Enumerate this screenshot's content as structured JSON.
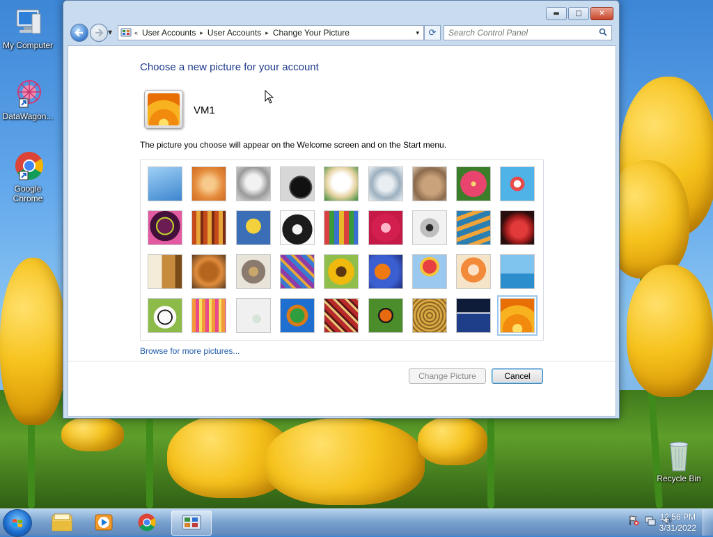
{
  "desktop": {
    "icons": [
      {
        "label": "My Computer",
        "icon": "computer-icon"
      },
      {
        "label": "DataWagon...",
        "icon": "datawagon-icon"
      },
      {
        "label": "Google Chrome",
        "icon": "chrome-icon"
      },
      {
        "label": "Recycle Bin",
        "icon": "recycle-bin-icon"
      }
    ]
  },
  "window": {
    "controls": {
      "minimize": "▬",
      "maximize": "□",
      "close": "✕"
    },
    "address": {
      "overflow": "«",
      "segments": [
        "User Accounts",
        "User Accounts",
        "Change Your Picture"
      ],
      "separator": "▸",
      "dropdown": "▾"
    },
    "search_placeholder": "Search Control Panel",
    "heading": "Choose a new picture for your account",
    "user_name": "VM1",
    "description": "The picture you choose will appear on the Welcome screen and on the Start menu.",
    "pictures": [
      "roller-coaster",
      "starfish",
      "robot-toy",
      "turntable",
      "lucky-cat",
      "gyroscope",
      "kitten",
      "pink-flower",
      "ferris-wheel",
      "bowling-ball",
      "fabric",
      "leaf",
      "dog",
      "crayons",
      "star-lamp",
      "jacks",
      "stairs",
      "paper-crane",
      "guitar",
      "puppy",
      "robot",
      "scarves",
      "sunflower",
      "fish",
      "hot-air-balloon",
      "doll",
      "sailboat",
      "soccer-ball",
      "silk",
      "marbles",
      "window",
      "textile",
      "butterfly",
      "basket",
      "lighthouse",
      "orange-daisy"
    ],
    "selected_picture_index": 35,
    "browse_link": "Browse for more pictures...",
    "buttons": {
      "change": "Change Picture",
      "cancel": "Cancel"
    },
    "change_enabled": false
  },
  "taskbar": {
    "apps": [
      "windows-explorer-icon",
      "media-player-icon",
      "chrome-icon",
      "control-panel-icon"
    ],
    "active_app": "control-panel-icon",
    "tray": [
      "action-center-flag-icon",
      "network-icon",
      "volume-icon"
    ],
    "time": "12:56 PM",
    "date": "3/31/2022"
  }
}
